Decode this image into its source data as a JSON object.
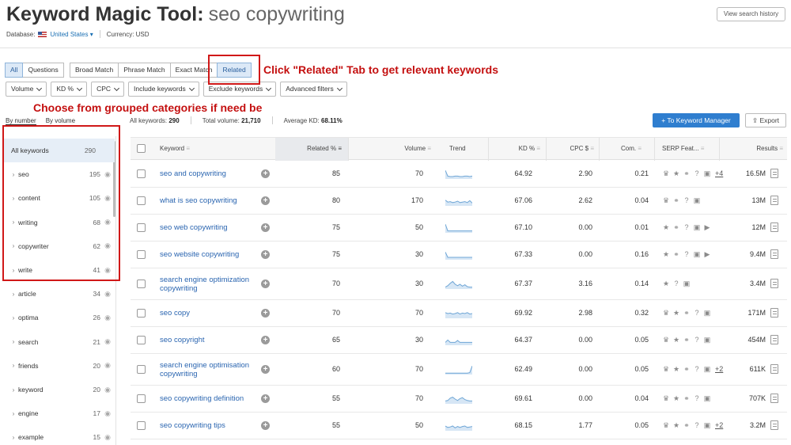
{
  "header": {
    "title": "Keyword Magic Tool:",
    "query": "seo copywriting",
    "history_button": "View search history",
    "database_label": "Database:",
    "database_value": "United States",
    "currency": "Currency: USD"
  },
  "tabs": {
    "all": "All",
    "questions": "Questions",
    "broad": "Broad Match",
    "phrase": "Phrase Match",
    "exact": "Exact Match",
    "related": "Related"
  },
  "filters": [
    "Volume",
    "KD %",
    "CPC",
    "Include keywords",
    "Exclude keywords",
    "Advanced filters"
  ],
  "annotations": {
    "related": "Click \"Related\" Tab to get relevant keywords",
    "groups": "Choose from grouped categories if need be"
  },
  "sidebar": {
    "by_number": "By number",
    "by_volume": "By volume",
    "groups": [
      {
        "name": "All keywords",
        "count": "290"
      },
      {
        "name": "seo",
        "count": "195"
      },
      {
        "name": "content",
        "count": "105"
      },
      {
        "name": "writing",
        "count": "68"
      },
      {
        "name": "copywriter",
        "count": "62"
      },
      {
        "name": "write",
        "count": "41"
      },
      {
        "name": "article",
        "count": "34"
      },
      {
        "name": "optima",
        "count": "26"
      },
      {
        "name": "search",
        "count": "21"
      },
      {
        "name": "friends",
        "count": "20"
      },
      {
        "name": "keyword",
        "count": "20"
      },
      {
        "name": "engine",
        "count": "17"
      },
      {
        "name": "example",
        "count": "15"
      }
    ]
  },
  "stats": {
    "all_label": "All keywords:",
    "all_value": "290",
    "volume_label": "Total volume:",
    "volume_value": "21,710",
    "kd_label": "Average KD:",
    "kd_value": "68.11%"
  },
  "buttons": {
    "to_keyword_manager": "To Keyword Manager",
    "export": "Export"
  },
  "table": {
    "headers": {
      "keyword": "Keyword",
      "related": "Related %",
      "volume": "Volume",
      "trend": "Trend",
      "kd": "KD %",
      "cpc": "CPC $",
      "com": "Com.",
      "serp": "SERP Feat...",
      "results": "Results"
    },
    "rows": [
      {
        "keyword": "seo and copywriting",
        "related": "85",
        "volume": "70",
        "kd": "64.92",
        "cpc": "2.90",
        "com": "0.21",
        "serp": [
          "crown-icon",
          "star-icon",
          "link-icon",
          "question-icon",
          "image-icon"
        ],
        "more": "+4",
        "results": "16.5M",
        "trend": [
          0.9,
          0.3,
          0.25,
          0.25,
          0.3,
          0.3,
          0.25,
          0.25,
          0.3,
          0.3,
          0.25,
          0.3
        ]
      },
      {
        "keyword": "what is seo copywriting",
        "related": "80",
        "volume": "170",
        "kd": "67.06",
        "cpc": "2.62",
        "com": "0.04",
        "serp": [
          "crown-icon",
          "link-icon",
          "question-icon",
          "image-icon"
        ],
        "more": "",
        "results": "13M",
        "trend": [
          0.6,
          0.4,
          0.45,
          0.35,
          0.4,
          0.5,
          0.35,
          0.4,
          0.45,
          0.35,
          0.55,
          0.3
        ]
      },
      {
        "keyword": "seo web copywriting",
        "related": "75",
        "volume": "50",
        "kd": "67.10",
        "cpc": "0.00",
        "com": "0.01",
        "serp": [
          "star-icon",
          "link-icon",
          "question-icon",
          "image-icon",
          "video-icon"
        ],
        "more": "",
        "results": "12M",
        "trend": [
          0.9,
          0.2,
          0.2,
          0.2,
          0.2,
          0.2,
          0.2,
          0.2,
          0.2,
          0.2,
          0.2,
          0.2
        ]
      },
      {
        "keyword": "seo website copywriting",
        "related": "75",
        "volume": "30",
        "kd": "67.33",
        "cpc": "0.00",
        "com": "0.16",
        "serp": [
          "star-icon",
          "link-icon",
          "question-icon",
          "image-icon",
          "video-icon"
        ],
        "more": "",
        "results": "9.4M",
        "trend": [
          0.8,
          0.25,
          0.25,
          0.25,
          0.25,
          0.25,
          0.25,
          0.25,
          0.25,
          0.25,
          0.25,
          0.25
        ]
      },
      {
        "keyword": "search engine optimization copywriting",
        "related": "70",
        "volume": "30",
        "kd": "67.37",
        "cpc": "3.16",
        "com": "0.14",
        "serp": [
          "star-icon",
          "question-icon",
          "image-icon"
        ],
        "more": "",
        "results": "3.4M",
        "trend": [
          0.2,
          0.35,
          0.6,
          0.8,
          0.5,
          0.35,
          0.5,
          0.3,
          0.45,
          0.25,
          0.2,
          0.2
        ]
      },
      {
        "keyword": "seo copy",
        "related": "70",
        "volume": "70",
        "kd": "69.92",
        "cpc": "2.98",
        "com": "0.32",
        "serp": [
          "crown-icon",
          "star-icon",
          "link-icon",
          "question-icon",
          "image-icon"
        ],
        "more": "",
        "results": "171M",
        "trend": [
          0.6,
          0.5,
          0.55,
          0.45,
          0.5,
          0.6,
          0.45,
          0.55,
          0.5,
          0.6,
          0.45,
          0.5
        ]
      },
      {
        "keyword": "seo copyright",
        "related": "65",
        "volume": "30",
        "kd": "64.37",
        "cpc": "0.00",
        "com": "0.05",
        "serp": [
          "crown-icon",
          "star-icon",
          "link-icon",
          "question-icon",
          "image-icon"
        ],
        "more": "",
        "results": "454M",
        "trend": [
          0.3,
          0.55,
          0.3,
          0.3,
          0.3,
          0.5,
          0.3,
          0.3,
          0.3,
          0.3,
          0.3,
          0.3
        ]
      },
      {
        "keyword": "search engine optimisation copywriting",
        "related": "60",
        "volume": "70",
        "kd": "62.49",
        "cpc": "0.00",
        "com": "0.05",
        "serp": [
          "crown-icon",
          "star-icon",
          "link-icon",
          "question-icon",
          "image-icon"
        ],
        "more": "+2",
        "results": "611K",
        "trend": [
          0.15,
          0.15,
          0.15,
          0.15,
          0.15,
          0.15,
          0.15,
          0.15,
          0.15,
          0.15,
          0.2,
          0.9
        ]
      },
      {
        "keyword": "seo copywriting definition",
        "related": "55",
        "volume": "70",
        "kd": "69.61",
        "cpc": "0.00",
        "com": "0.04",
        "serp": [
          "crown-icon",
          "star-icon",
          "link-icon",
          "question-icon",
          "image-icon"
        ],
        "more": "",
        "results": "707K",
        "trend": [
          0.3,
          0.35,
          0.6,
          0.7,
          0.5,
          0.35,
          0.55,
          0.65,
          0.45,
          0.35,
          0.3,
          0.3
        ]
      },
      {
        "keyword": "seo copywriting tips",
        "related": "55",
        "volume": "50",
        "kd": "68.15",
        "cpc": "1.77",
        "com": "0.05",
        "serp": [
          "crown-icon",
          "star-icon",
          "link-icon",
          "question-icon",
          "image-icon"
        ],
        "more": "+2",
        "results": "3.2M",
        "trend": [
          0.5,
          0.35,
          0.4,
          0.5,
          0.3,
          0.45,
          0.35,
          0.45,
          0.5,
          0.35,
          0.4,
          0.45
        ]
      }
    ]
  }
}
